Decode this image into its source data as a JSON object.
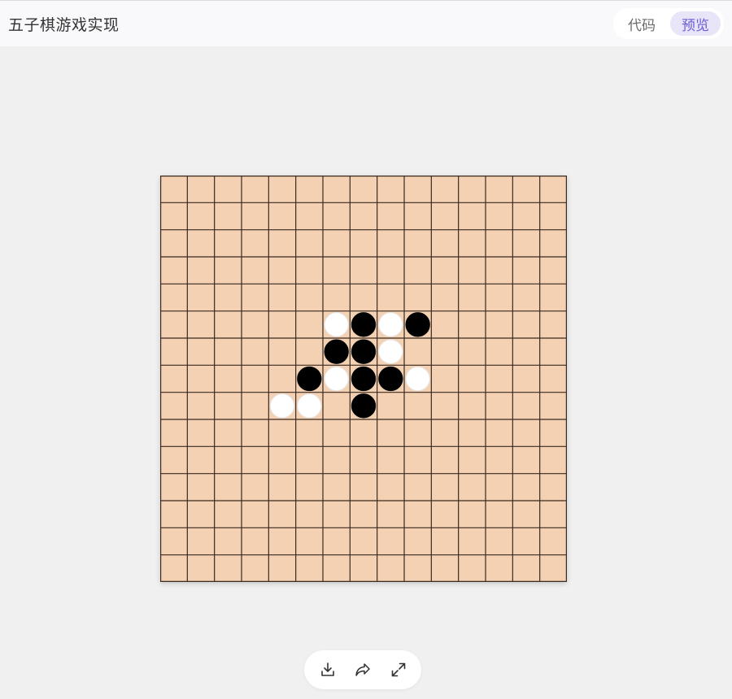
{
  "header": {
    "title": "五子棋游戏实现",
    "tabs": [
      {
        "label": "代码",
        "active": false
      },
      {
        "label": "预览",
        "active": true
      }
    ]
  },
  "board": {
    "size": 15,
    "background_color": "#f4d1b3",
    "line_color": "#3a2a20",
    "stones": [
      {
        "row": 5,
        "col": 6,
        "color": "white"
      },
      {
        "row": 5,
        "col": 7,
        "color": "black"
      },
      {
        "row": 5,
        "col": 8,
        "color": "white"
      },
      {
        "row": 5,
        "col": 9,
        "color": "black"
      },
      {
        "row": 6,
        "col": 6,
        "color": "black"
      },
      {
        "row": 6,
        "col": 7,
        "color": "black"
      },
      {
        "row": 6,
        "col": 8,
        "color": "white"
      },
      {
        "row": 7,
        "col": 5,
        "color": "black"
      },
      {
        "row": 7,
        "col": 6,
        "color": "white"
      },
      {
        "row": 7,
        "col": 7,
        "color": "black"
      },
      {
        "row": 7,
        "col": 8,
        "color": "black"
      },
      {
        "row": 7,
        "col": 9,
        "color": "white"
      },
      {
        "row": 8,
        "col": 4,
        "color": "white"
      },
      {
        "row": 8,
        "col": 5,
        "color": "white"
      },
      {
        "row": 8,
        "col": 7,
        "color": "black"
      }
    ]
  },
  "toolbar": {
    "icons": [
      "download-icon",
      "share-icon",
      "fullscreen-icon"
    ]
  }
}
